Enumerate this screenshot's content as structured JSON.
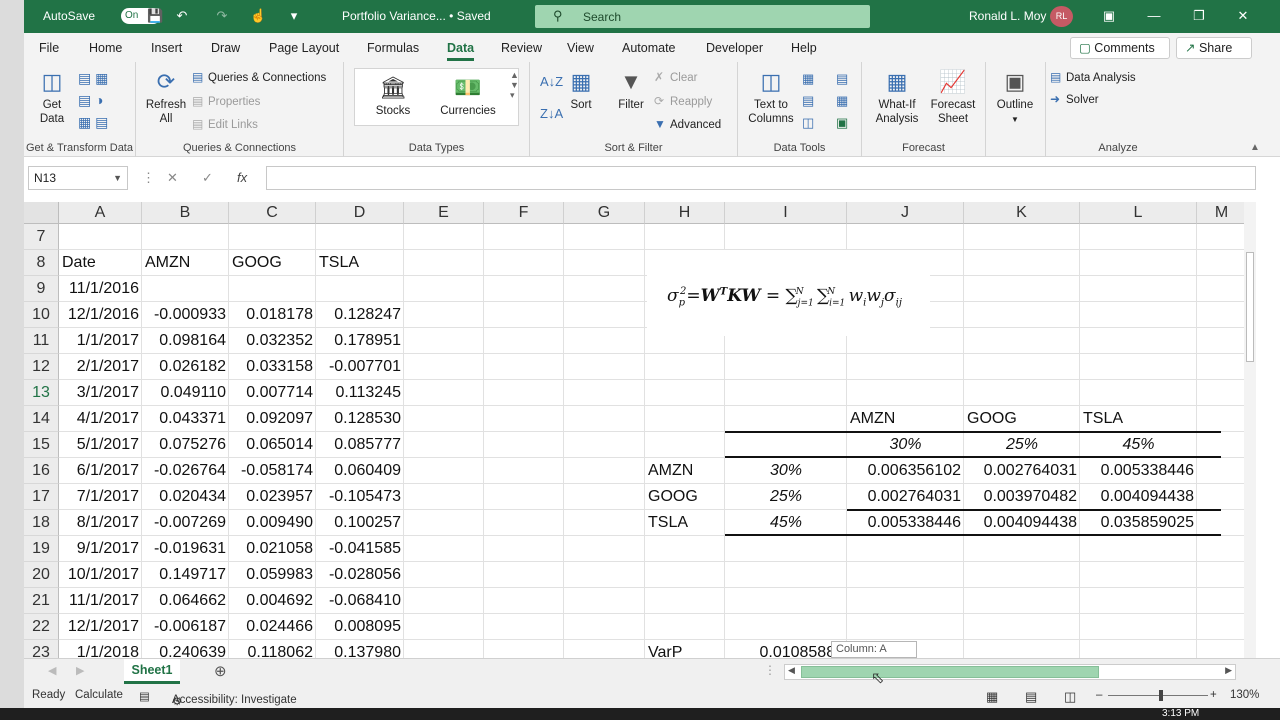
{
  "titlebar": {
    "autosave_label": "AutoSave",
    "autosave_state": "On",
    "doc_title": "Portfolio Variance... • Saved",
    "search_placeholder": "Search",
    "user_name": "Ronald L. Moy",
    "user_initials": "RL"
  },
  "menu": {
    "items": [
      "File",
      "Home",
      "Insert",
      "Draw",
      "Page Layout",
      "Formulas",
      "Data",
      "Review",
      "View",
      "Automate",
      "Developer",
      "Help"
    ],
    "active": "Data",
    "comments_label": "Comments",
    "share_label": "Share"
  },
  "ribbon": {
    "get_data": "Get Data",
    "refresh_all": "Refresh All",
    "queries_connections": "Queries & Connections",
    "properties": "Properties",
    "edit_links": "Edit Links",
    "stocks": "Stocks",
    "currencies": "Currencies",
    "sort": "Sort",
    "filter": "Filter",
    "clear": "Clear",
    "reapply": "Reapply",
    "advanced": "Advanced",
    "text_to_columns": "Text to Columns",
    "what_if": "What-If Analysis",
    "forecast_sheet": "Forecast Sheet",
    "outline": "Outline",
    "data_analysis": "Data Analysis",
    "solver": "Solver",
    "groups": {
      "get_transform": "Get & Transform Data",
      "queries": "Queries & Connections",
      "data_types": "Data Types",
      "sort_filter": "Sort & Filter",
      "data_tools": "Data Tools",
      "forecast": "Forecast",
      "analyze": "Analyze"
    }
  },
  "formula_bar": {
    "name_box": "N13",
    "fx": "fx",
    "value": ""
  },
  "columns": [
    "A",
    "B",
    "C",
    "D",
    "E",
    "F",
    "G",
    "H",
    "I",
    "J",
    "K",
    "L",
    "M"
  ],
  "rows": [
    "7",
    "8",
    "9",
    "10",
    "11",
    "12",
    "13",
    "14",
    "15",
    "16",
    "17",
    "18",
    "19",
    "20",
    "21",
    "22",
    "23"
  ],
  "data_table": {
    "headers": [
      "Date",
      "AMZN",
      "GOOG",
      "TSLA"
    ],
    "rows": [
      [
        "11/1/2016",
        "",
        "",
        ""
      ],
      [
        "12/1/2016",
        "-0.000933",
        "0.018178",
        "0.128247"
      ],
      [
        "1/1/2017",
        "0.098164",
        "0.032352",
        "0.178951"
      ],
      [
        "2/1/2017",
        "0.026182",
        "0.033158",
        "-0.007701"
      ],
      [
        "3/1/2017",
        "0.049110",
        "0.007714",
        "0.113245"
      ],
      [
        "4/1/2017",
        "0.043371",
        "0.092097",
        "0.128530"
      ],
      [
        "5/1/2017",
        "0.075276",
        "0.065014",
        "0.085777"
      ],
      [
        "6/1/2017",
        "-0.026764",
        "-0.058174",
        "0.060409"
      ],
      [
        "7/1/2017",
        "0.020434",
        "0.023957",
        "-0.105473"
      ],
      [
        "8/1/2017",
        "-0.007269",
        "0.009490",
        "0.100257"
      ],
      [
        "9/1/2017",
        "-0.019631",
        "0.021058",
        "-0.041585"
      ],
      [
        "10/1/2017",
        "0.149717",
        "0.059983",
        "-0.028056"
      ],
      [
        "11/1/2017",
        "0.064662",
        "0.004692",
        "-0.068410"
      ],
      [
        "12/1/2017",
        "-0.006187",
        "0.024466",
        "0.008095"
      ],
      [
        "1/1/2018",
        "0.240639",
        "0.118062",
        "0.137980"
      ]
    ]
  },
  "formula_image": {
    "sigma": "σ",
    "p": "p",
    "two": "2",
    "eq1": "=",
    "WTKW": "W",
    "T": "T",
    "KW": "KW",
    "eq2": " = ",
    "sum": "∑",
    "N": "N",
    "j1": "j=1",
    "i1": "i=1",
    "rest": "w",
    "iw": "i",
    "jw": "j",
    "ij": "ij"
  },
  "cov_matrix": {
    "col_headers": [
      "AMZN",
      "GOOG",
      "TSLA"
    ],
    "col_weights": [
      "30%",
      "25%",
      "45%"
    ],
    "row_labels": [
      "AMZN",
      "GOOG",
      "TSLA"
    ],
    "row_weights": [
      "30%",
      "25%",
      "45%"
    ],
    "values": [
      [
        "0.006356102",
        "0.002764031",
        "0.005338446"
      ],
      [
        "0.002764031",
        "0.003970482",
        "0.004094438"
      ],
      [
        "0.005338446",
        "0.004094438",
        "0.035859025"
      ]
    ]
  },
  "varp": {
    "label": "VarP",
    "value": "0.01085889"
  },
  "tooltip": "Column: A",
  "sheet_tab": "Sheet1",
  "status": {
    "ready": "Ready",
    "calculate": "Calculate",
    "accessibility": "Accessibility: Investigate",
    "zoom": "130%"
  },
  "taskbar": {
    "time": "3:13 PM"
  }
}
